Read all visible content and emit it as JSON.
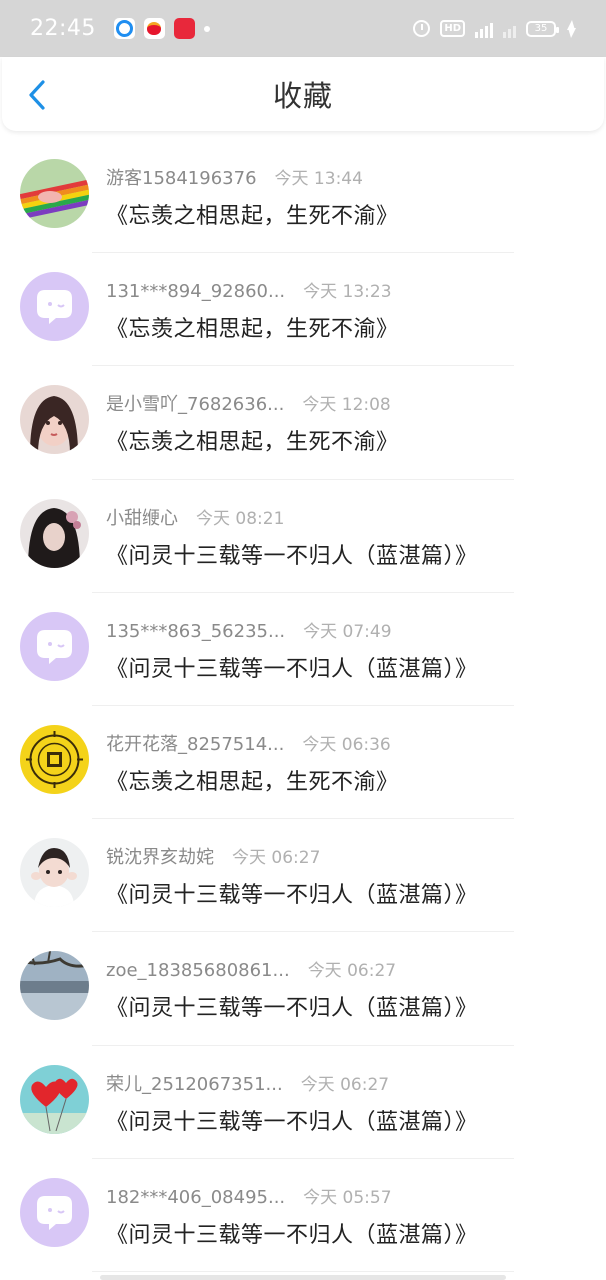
{
  "status_bar": {
    "time": "22:45",
    "network_label": "4G",
    "hd_label": "HD",
    "battery": "35"
  },
  "header": {
    "title": "收藏",
    "back_icon": "chevron-left-icon"
  },
  "items": [
    {
      "user": "游客1584196376",
      "time": "今天 13:44",
      "title": "《忘羡之相思起，生死不渝》",
      "avatar": "rainbow-hands"
    },
    {
      "user": "131***894_92860...",
      "time": "今天 13:23",
      "title": "《忘羡之相思起，生死不渝》",
      "avatar": "default-chat"
    },
    {
      "user": "是小雪吖_7682636...",
      "time": "今天 12:08",
      "title": "《忘羡之相思起，生死不渝》",
      "avatar": "girl-photo"
    },
    {
      "user": "小甜缏心",
      "time": "今天 08:21",
      "title": "《问灵十三载等一不归人（蓝湛篇）》",
      "avatar": "dark-portrait"
    },
    {
      "user": "135***863_56235...",
      "time": "今天 07:49",
      "title": "《问灵十三载等一不归人（蓝湛篇）》",
      "avatar": "default-chat"
    },
    {
      "user": "花开花落_8257514...",
      "time": "今天 06:36",
      "title": "《忘羡之相思起，生死不渝》",
      "avatar": "yellow-bagua"
    },
    {
      "user": "锐沈界亥劫姹",
      "time": "今天 06:27",
      "title": "《问灵十三载等一不归人（蓝湛篇）》",
      "avatar": "child-photo"
    },
    {
      "user": "zoe_18385680861...",
      "time": "今天 06:27",
      "title": "《问灵十三载等一不归人（蓝湛篇）》",
      "avatar": "lake-landscape"
    },
    {
      "user": "荣儿_2512067351...",
      "time": "今天 06:27",
      "title": "《问灵十三载等一不归人（蓝湛篇）》",
      "avatar": "red-balloons"
    },
    {
      "user": "182***406_08495...",
      "time": "今天 05:57",
      "title": "《问灵十三载等一不归人（蓝湛篇）》",
      "avatar": "default-chat"
    }
  ],
  "colors": {
    "accent": "#1e90e6",
    "default_avatar": "#d9c8f5"
  }
}
